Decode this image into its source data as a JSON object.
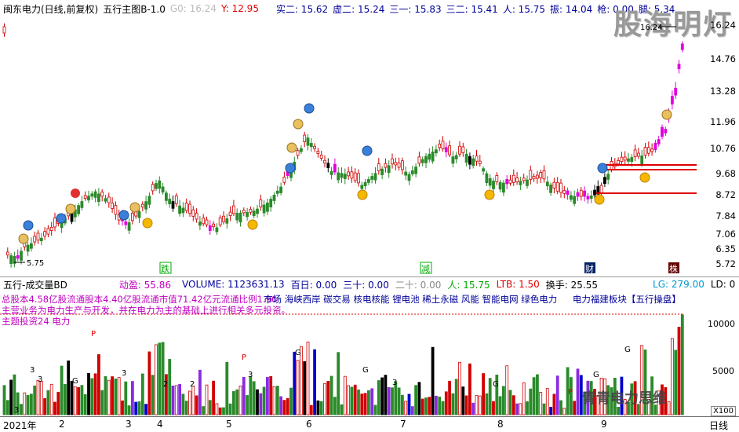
{
  "header": {
    "stock_title": "闽东电力(日线,前复权)",
    "indicator_name": "五行主图B-1.0",
    "g0": "G0: 16.24",
    "y": "Y: 12.95",
    "shi_er": "实二: 15.62",
    "xu_er": "虚二: 15.24",
    "san_yi": "三一: 15.83",
    "san_er": "三二: 15.41",
    "ren": "人: 15.75",
    "zhen": "振: 14.04",
    "qiang": "枪: 0.00",
    "tui": "腿: 5.34"
  },
  "logo": "股海明灯",
  "price_axis": [
    "16.24",
    "14.76",
    "13.28",
    "11.96",
    "10.76",
    "9.68",
    "8.72",
    "7.84",
    "7.06",
    "6.35",
    "5.72"
  ],
  "price_marks": {
    "high": "16.24",
    "low": "5.75"
  },
  "signal_labels": [
    "跌",
    "减",
    "财",
    "株"
  ],
  "volume_header": {
    "name": "五行-成交量BD",
    "dong_ying": "动盈: 55.86",
    "volume": "VOLUME: 1123631.13",
    "bai_ri": "百日: 0.00",
    "san_shi": "三十: 0.00",
    "er_shi": "二十: 0.00",
    "ren": "人: 15.75",
    "ltb": "LTB: 1.50",
    "huan_shou": "换手: 25.55",
    "lg": "LG: 279.00",
    "ld": "LD: 0"
  },
  "info_lines": [
    "总股本4.58亿股流通股本4.40亿股流通市值71.42亿元流通比例1.96",
    "主营业务为电力生产与开发，并在电力为主的基础上进行相关多元投资。",
    "主题投资24 电力"
  ],
  "concepts": "市场 海峡西岸 碳交易 核电核能 锂电池 稀土永磁 风能 智能电网 绿色电力",
  "concept_right": "电力福建板块【五行操盘】",
  "volume_axis": [
    "10000",
    "5000"
  ],
  "volume_unit": "X100",
  "x_axis": {
    "year": "2021年",
    "months": [
      "2",
      "3",
      "4",
      "5",
      "6",
      "7",
      "8",
      "9"
    ],
    "period": "日线"
  },
  "watermark": "青青电力思维"
}
